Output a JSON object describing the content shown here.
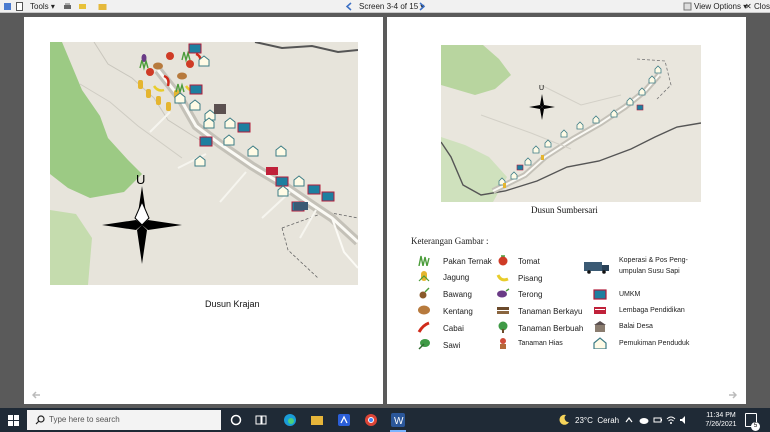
{
  "toolbar": {
    "tools_label": "Tools",
    "screen_label": "Screen 3-4 of 15",
    "view_options_label": "View Options",
    "close_label": "Close"
  },
  "left_page": {
    "caption": "Dusun Krajan",
    "compass_letter": "U"
  },
  "right_page": {
    "caption": "Dusun Sumbersari",
    "compass_letter": "U",
    "legend_title": "Keterangan Gambar :",
    "legend": [
      {
        "icon": "grass-icon",
        "label": "Pakan Ternak"
      },
      {
        "icon": "corn-icon",
        "label": "Jagung"
      },
      {
        "icon": "onion-icon",
        "label": "Bawang"
      },
      {
        "icon": "potato-icon",
        "label": "Kentang"
      },
      {
        "icon": "chili-icon",
        "label": "Cabai"
      },
      {
        "icon": "mustard-greens-icon",
        "label": "Sawi"
      },
      {
        "icon": "tomato-icon",
        "label": "Tomat"
      },
      {
        "icon": "banana-icon",
        "label": "Pisang"
      },
      {
        "icon": "eggplant-icon",
        "label": "Terong"
      },
      {
        "icon": "timber-icon",
        "label": "Tanaman Berkayu"
      },
      {
        "icon": "fruit-tree-icon",
        "label": "Tanaman Berbuah"
      },
      {
        "icon": "potted-plant-icon",
        "label": "Tanaman Hias"
      },
      {
        "icon": "milk-truck-icon",
        "label": "Koperasi & Pos Peng-\numpulan Susu Sapi"
      },
      {
        "icon": "shop-icon",
        "label": "UMKM"
      },
      {
        "icon": "book-icon",
        "label": "Lembaga Pendidikan"
      },
      {
        "icon": "village-hall-icon",
        "label": "Balai Desa"
      },
      {
        "icon": "house-icon",
        "label": "Pemukiman Penduduk"
      }
    ]
  },
  "taskbar": {
    "search_placeholder": "Type here to search",
    "weather": "23°C  Cerah",
    "time": "11:34 PM",
    "date": "7/26/2021"
  }
}
